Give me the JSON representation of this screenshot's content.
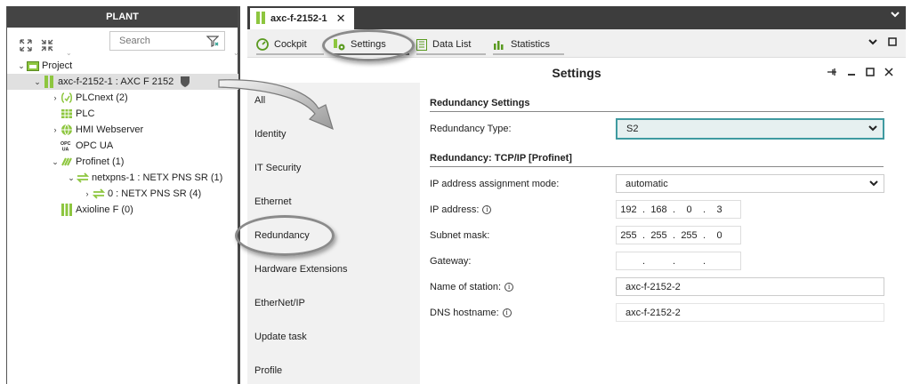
{
  "plant": {
    "header": "PLANT",
    "search_placeholder": "Search",
    "tree": [
      {
        "label": "Project"
      },
      {
        "label": "axc-f-2152-1 : AXC F 2152"
      },
      {
        "label": "PLCnext (2)"
      },
      {
        "label": "PLC"
      },
      {
        "label": "HMI Webserver"
      },
      {
        "label": "OPC UA"
      },
      {
        "label": "Profinet (1)"
      },
      {
        "label": "netxpns-1 : NETX PNS SR (1)"
      },
      {
        "label": "0 : NETX PNS SR (4)"
      },
      {
        "label": "Axioline F (0)"
      }
    ]
  },
  "doc_tab": {
    "label": "axc-f-2152-1",
    "close": "✕"
  },
  "editor_tabs": [
    {
      "label": "Cockpit"
    },
    {
      "label": "Settings"
    },
    {
      "label": "Data List"
    },
    {
      "label": "Statistics"
    }
  ],
  "settings": {
    "title": "Settings",
    "nav": [
      {
        "label": "All"
      },
      {
        "label": "Identity"
      },
      {
        "label": "IT Security"
      },
      {
        "label": "Ethernet"
      },
      {
        "label": "Redundancy"
      },
      {
        "label": "Hardware Extensions"
      },
      {
        "label": "EtherNet/IP"
      },
      {
        "label": "Update task"
      },
      {
        "label": "Profile"
      }
    ],
    "redundancy_settings": {
      "heading": "Redundancy Settings",
      "type_label": "Redundancy Type:",
      "type_value": "S2"
    },
    "tcpip": {
      "heading": "Redundancy: TCP/IP [Profinet]",
      "mode_label": "IP address assignment mode:",
      "mode_value": "automatic",
      "ip_label": "IP address:",
      "ip": [
        "192",
        "168",
        "0",
        "3"
      ],
      "subnet_label": "Subnet mask:",
      "subnet": [
        "255",
        "255",
        "255",
        "0"
      ],
      "gateway_label": "Gateway:",
      "gateway": [
        "",
        "",
        "",
        ""
      ],
      "station_label": "Name of station:",
      "station_value": "axc-f-2152-2",
      "dns_label": "DNS hostname:",
      "dns_value": "axc-f-2152-2",
      "info_glyph": "i"
    }
  },
  "colors": {
    "accent_green": "#8dc63f",
    "dark_bar": "#3d3d3d",
    "select_border": "#3f9aa0"
  },
  "icons": [
    "expand-all-icon",
    "collapse-all-icon",
    "filter-icon",
    "project-icon",
    "controller-icon",
    "shield-icon",
    "plcnext-icon",
    "plc-icon",
    "hmi-globe-icon",
    "opcua-icon",
    "profinet-icon",
    "network-icon",
    "axioline-icon",
    "cockpit-icon",
    "settings-icon",
    "data-list-icon",
    "statistics-icon",
    "pin-icon",
    "minimize-icon",
    "maximize-icon",
    "close-icon",
    "info-icon"
  ]
}
